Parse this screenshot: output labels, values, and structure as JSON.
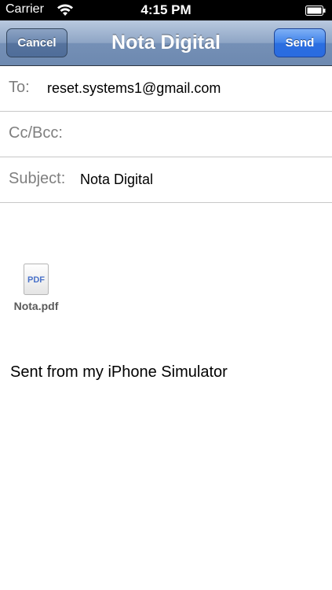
{
  "status_bar": {
    "carrier": "Carrier",
    "time": "4:15 PM",
    "wifi_icon": "wifi-icon",
    "battery_icon": "battery-icon"
  },
  "nav": {
    "title": "Nota Digital",
    "cancel_label": "Cancel",
    "send_label": "Send"
  },
  "fields": {
    "to_label": "To:",
    "to_value": "reset.systems1@gmail.com",
    "ccbcc_label": "Cc/Bcc:",
    "subject_label": "Subject:",
    "subject_value": "Nota Digital"
  },
  "attachment": {
    "icon_text": "PDF",
    "filename": "Nota.pdf"
  },
  "body": {
    "signature": "Sent from my iPhone Simulator"
  },
  "colors": {
    "status_bar_bg": "#000000",
    "nav_bar": "#7590b6",
    "send_button": "#2b6fe0",
    "label_gray": "#7f7f7f",
    "separator": "#c8c8c8"
  }
}
